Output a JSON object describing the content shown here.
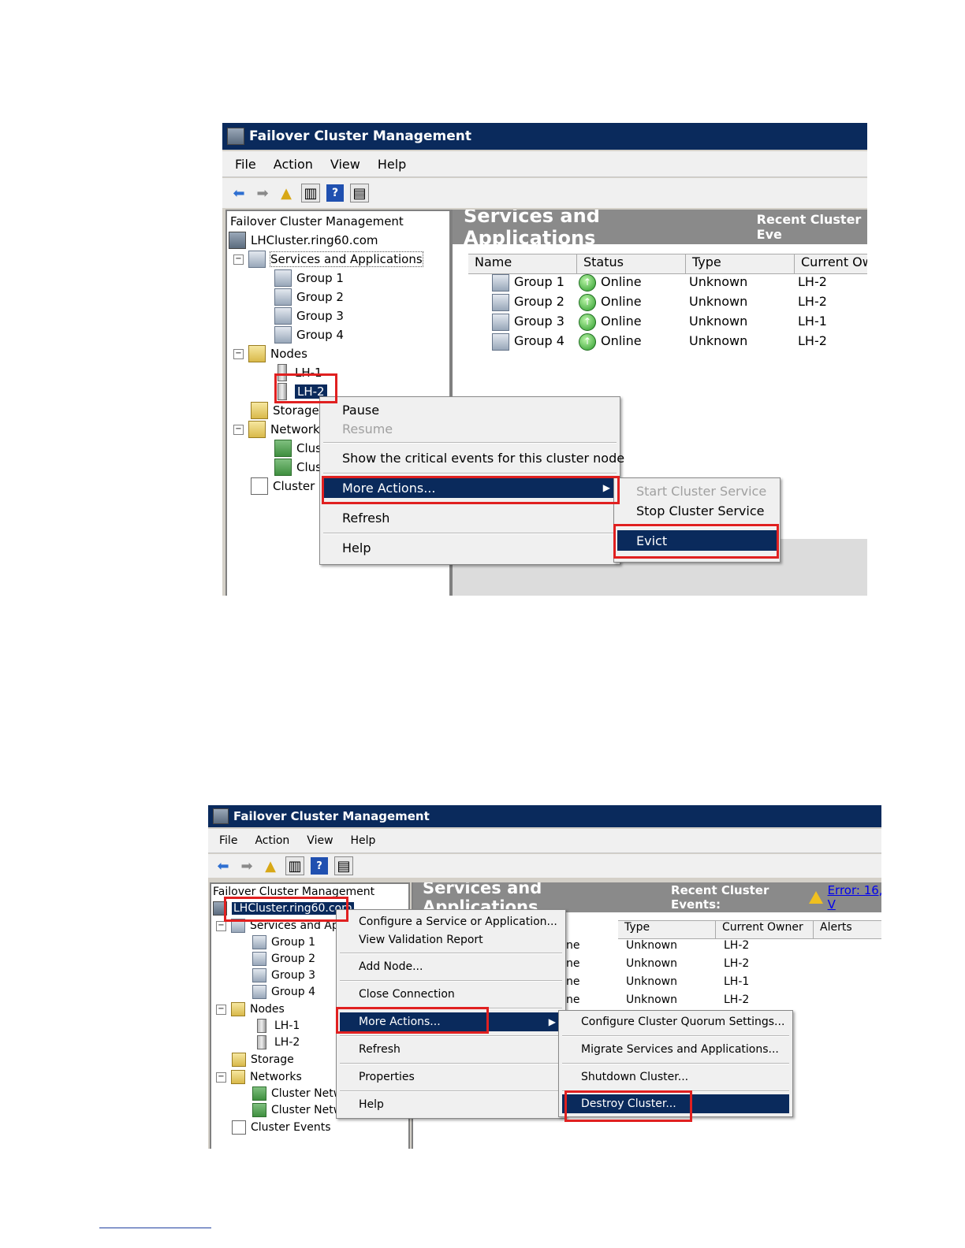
{
  "s1": {
    "title": "Failover Cluster Management",
    "menu": [
      "File",
      "Action",
      "View",
      "Help"
    ],
    "tree": {
      "root": "Failover Cluster Management",
      "cluster": "LHCluster.ring60.com",
      "services": "Services and Applications",
      "groups": [
        "Group 1",
        "Group 2",
        "Group 3",
        "Group 4"
      ],
      "nodes_label": "Nodes",
      "nodes": [
        "LH-1",
        "LH-2"
      ],
      "storage": "Storage",
      "networks": "Network",
      "net_items": [
        "Clus",
        "Clus"
      ],
      "events": "Cluster I"
    },
    "pane": {
      "title": "Services and Applications",
      "recent": "Recent Cluster Eve",
      "columns": [
        "Name",
        "Status",
        "Type",
        "Current Owi"
      ],
      "rows": [
        {
          "name": "Group 1",
          "status": "Online",
          "type": "Unknown",
          "owner": "LH-2"
        },
        {
          "name": "Group 2",
          "status": "Online",
          "type": "Unknown",
          "owner": "LH-2"
        },
        {
          "name": "Group 3",
          "status": "Online",
          "type": "Unknown",
          "owner": "LH-1"
        },
        {
          "name": "Group 4",
          "status": "Online",
          "type": "Unknown",
          "owner": "LH-2"
        }
      ]
    },
    "context_menu": {
      "pause": "Pause",
      "resume": "Resume",
      "critical": "Show the critical events for this cluster node",
      "more": "More Actions...",
      "refresh": "Refresh",
      "help": "Help"
    },
    "submenu": {
      "start": "Start Cluster Service",
      "stop": "Stop Cluster Service",
      "evict": "Evict"
    }
  },
  "s2": {
    "title": "Failover Cluster Management",
    "menu": [
      "File",
      "Action",
      "View",
      "Help"
    ],
    "tree": {
      "root": "Failover Cluster Management",
      "cluster": "LHCluster.ring60.com",
      "services": "Services and Ap",
      "groups": [
        "Group 1",
        "Group 2",
        "Group 3",
        "Group 4"
      ],
      "nodes_label": "Nodes",
      "nodes": [
        "LH-1",
        "LH-2"
      ],
      "storage": "Storage",
      "networks": "Networks",
      "net_items": [
        "Cluster Netw",
        "Cluster Netw"
      ],
      "events": "Cluster Events"
    },
    "pane": {
      "title": "Services and Applications",
      "recent": "Recent Cluster Events:",
      "link": "Error: 16, V",
      "columns": [
        "Type",
        "Current Owner",
        "Alerts"
      ],
      "rows": [
        {
          "status": "ne",
          "type": "Unknown",
          "owner": "LH-2"
        },
        {
          "status": "ne",
          "type": "Unknown",
          "owner": "LH-2"
        },
        {
          "status": "ne",
          "type": "Unknown",
          "owner": "LH-1"
        },
        {
          "status": "ne",
          "type": "Unknown",
          "owner": "LH-2"
        }
      ]
    },
    "context_menu": {
      "configure": "Configure a Service or Application...",
      "validation": "View Validation Report",
      "add_node": "Add Node...",
      "close": "Close Connection",
      "more": "More Actions...",
      "refresh": "Refresh",
      "properties": "Properties",
      "help": "Help"
    },
    "submenu": {
      "quorum": "Configure Cluster Quorum Settings...",
      "migrate": "Migrate Services and Applications...",
      "shutdown": "Shutdown Cluster...",
      "destroy": "Destroy Cluster..."
    }
  }
}
